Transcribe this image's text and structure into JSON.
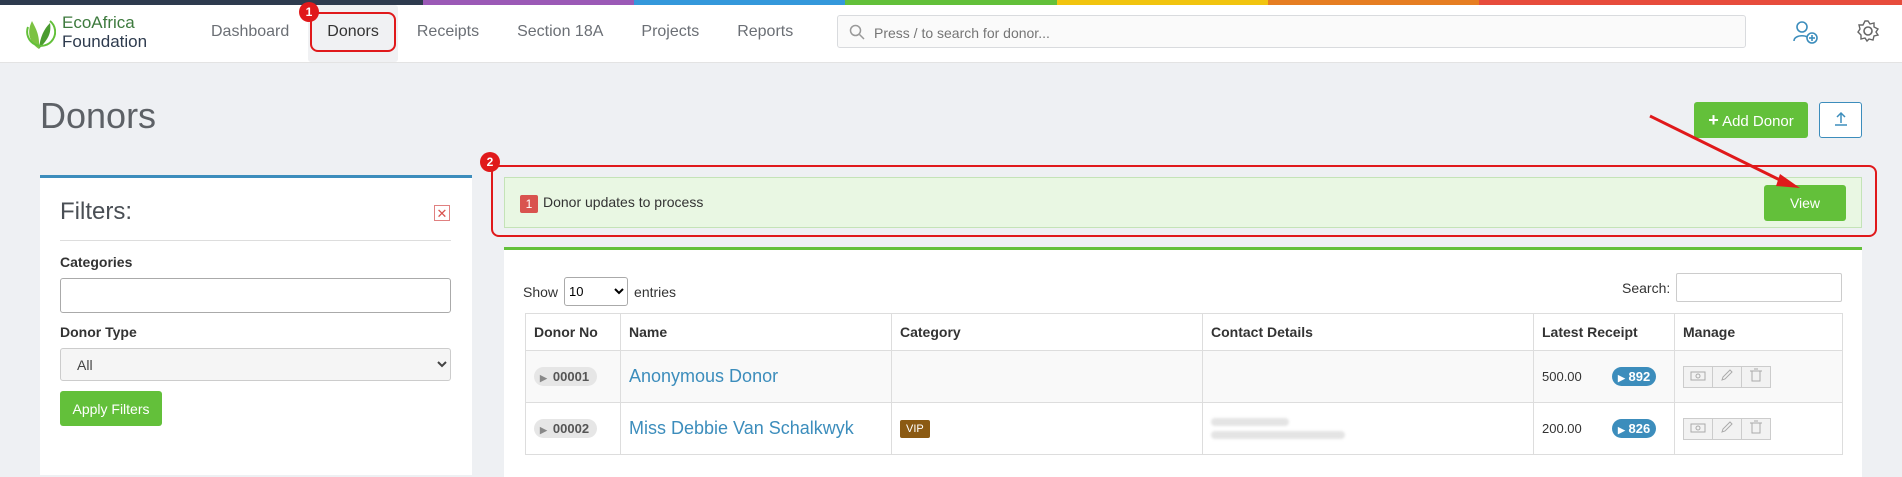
{
  "rainbow_colors": [
    "#2e3b4e",
    "#2e3b4e",
    "#9b59b6",
    "#3498db",
    "#63c03a",
    "#f1c40f",
    "#e67e22",
    "#e74c3c",
    "#e74c3c"
  ],
  "brand": {
    "line1": "EcoAfrica",
    "line2": "Foundation",
    "accent": "#63c03a"
  },
  "nav": {
    "items": [
      {
        "label": "Dashboard"
      },
      {
        "label": "Donors",
        "active": true
      },
      {
        "label": "Receipts"
      },
      {
        "label": "Section 18A"
      },
      {
        "label": "Projects"
      },
      {
        "label": "Reports"
      }
    ]
  },
  "search": {
    "placeholder": "Press / to search for donor..."
  },
  "page": {
    "title": "Donors"
  },
  "toolbar": {
    "add_label": "Add Donor"
  },
  "filters": {
    "title": "Filters:",
    "categories_label": "Categories",
    "donor_type_label": "Donor Type",
    "donor_type_value": "All",
    "apply_label": "Apply Filters"
  },
  "alert": {
    "count": "1",
    "message": "Donor updates to process",
    "view_label": "View"
  },
  "callouts": {
    "one": "1",
    "two": "2"
  },
  "table": {
    "show_label": "Show",
    "entries_value": "10",
    "entries_label": "entries",
    "search_label": "Search:",
    "columns": [
      "Donor No",
      "Name",
      "Category",
      "Contact Details",
      "Latest Receipt",
      "Manage"
    ],
    "rows": [
      {
        "donor_no": "00001",
        "name": "Anonymous Donor",
        "category": "",
        "amount": "500.00",
        "receipt": "892"
      },
      {
        "donor_no": "00002",
        "name": "Miss Debbie Van Schalkwyk",
        "category": "VIP",
        "amount": "200.00",
        "receipt": "826"
      }
    ]
  }
}
